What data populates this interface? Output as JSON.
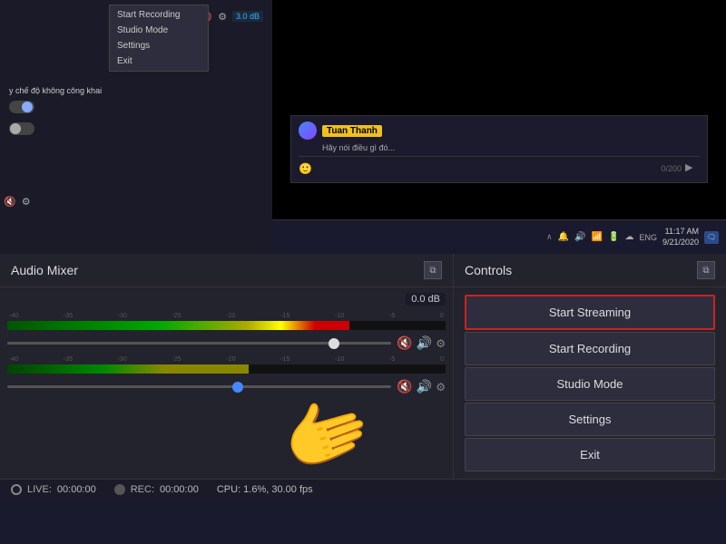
{
  "panels": {
    "audio_mixer": {
      "title": "Audio Mixer",
      "db_value": "0.0 dB",
      "scale_ticks": [
        "-40",
        "-35",
        "-30",
        "-25",
        "-20",
        "-15",
        "-10",
        "-5",
        "0"
      ]
    },
    "controls": {
      "title": "Controls",
      "buttons": [
        {
          "label": "Start Streaming",
          "id": "start-streaming",
          "highlighted": true
        },
        {
          "label": "Start Recording",
          "id": "start-recording",
          "highlighted": false
        },
        {
          "label": "Studio Mode",
          "id": "studio-mode",
          "highlighted": false
        },
        {
          "label": "Settings",
          "id": "settings",
          "highlighted": false
        },
        {
          "label": "Exit",
          "id": "exit",
          "highlighted": false
        }
      ]
    }
  },
  "status_bar": {
    "live_label": "LIVE:",
    "live_time": "00:00:00",
    "rec_label": "REC:",
    "rec_time": "00:00:00",
    "cpu_label": "CPU: 1.6%, 30.00 fps"
  },
  "chat": {
    "user_name": "Tuan Thanh",
    "message": "Hãy nói điều gì đó...",
    "char_count": "0/200"
  },
  "tray": {
    "time": "11:17 AM",
    "date": "9/21/2020"
  },
  "mini_dropdown": {
    "items": [
      "Start Recording",
      "Studio Mode",
      "Settings",
      "Exit"
    ]
  },
  "top_panel": {
    "left_text": "y chế độ không công khai",
    "db_display": "3.0 dB"
  }
}
